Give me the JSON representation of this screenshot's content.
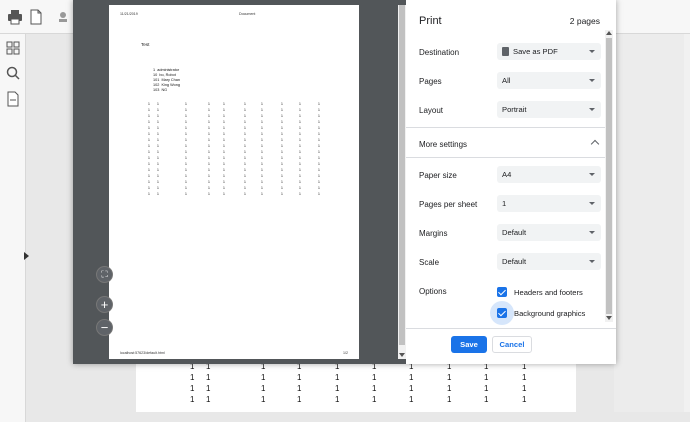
{
  "dialog": {
    "title": "Print",
    "page_count": "2 pages",
    "destination": {
      "label": "Destination",
      "value": "Save as PDF"
    },
    "pages": {
      "label": "Pages",
      "value": "All"
    },
    "layout": {
      "label": "Layout",
      "value": "Portrait"
    },
    "more_settings": "More settings",
    "paper_size": {
      "label": "Paper size",
      "value": "A4"
    },
    "pages_per_sheet": {
      "label": "Pages per sheet",
      "value": "1"
    },
    "margins": {
      "label": "Margins",
      "value": "Default"
    },
    "scale": {
      "label": "Scale",
      "value": "Default"
    },
    "options": {
      "label": "Options",
      "headers_footers": {
        "label": "Headers and footers",
        "checked": true
      },
      "background_graphics": {
        "label": "Background graphics",
        "checked": true
      }
    },
    "save_label": "Save",
    "cancel_label": "Cancel"
  },
  "preview": {
    "header_left": "11/21/2019",
    "header_center": "Document",
    "heading": "Test",
    "users": [
      "1  administrator",
      "10  bo, Robot",
      "101  Mary Chan",
      "102  King Wong",
      "103  NG"
    ],
    "footer_left": "localhost:57623/default.html",
    "footer_right": "1/2",
    "grid_value": "1"
  },
  "background": {
    "grid_value": "1"
  },
  "icons": {
    "toolbar": [
      "print-icon",
      "document-icon",
      "stamp-icon"
    ],
    "rail": [
      "thumbnails-icon",
      "search-icon",
      "attachment-icon"
    ],
    "zoom": [
      "fit-page-icon",
      "zoom-in-icon",
      "zoom-out-icon"
    ]
  }
}
